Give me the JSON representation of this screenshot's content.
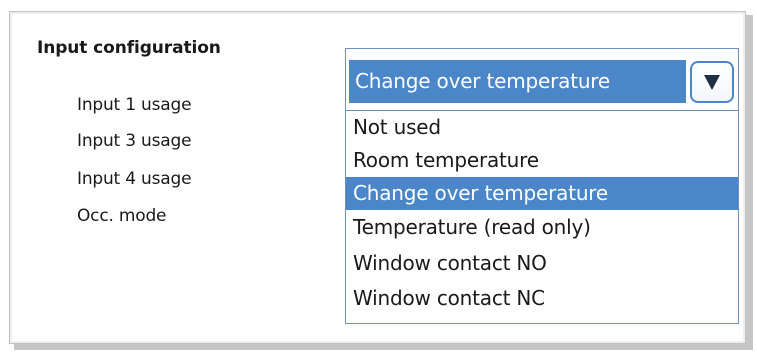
{
  "panel": {
    "title": "Input configuration",
    "labels": [
      "Input 1 usage",
      "Input 3 usage",
      "Input 4 usage",
      "Occ. mode"
    ]
  },
  "dropdown": {
    "selected_value": "Change over temperature",
    "button_icon": "triangle-down-icon",
    "options": [
      {
        "label": "Not used",
        "selected": false
      },
      {
        "label": "Room temperature",
        "selected": false
      },
      {
        "label": "Change over temperature",
        "selected": true
      },
      {
        "label": "Temperature (read only)",
        "selected": false
      },
      {
        "label": "Window contact NO",
        "selected": false
      },
      {
        "label": "Window contact NC",
        "selected": false
      }
    ]
  },
  "colors": {
    "accent": "#4b86c8",
    "border": "#6e8fbf",
    "frame_shadow": "#c6c6c6"
  }
}
